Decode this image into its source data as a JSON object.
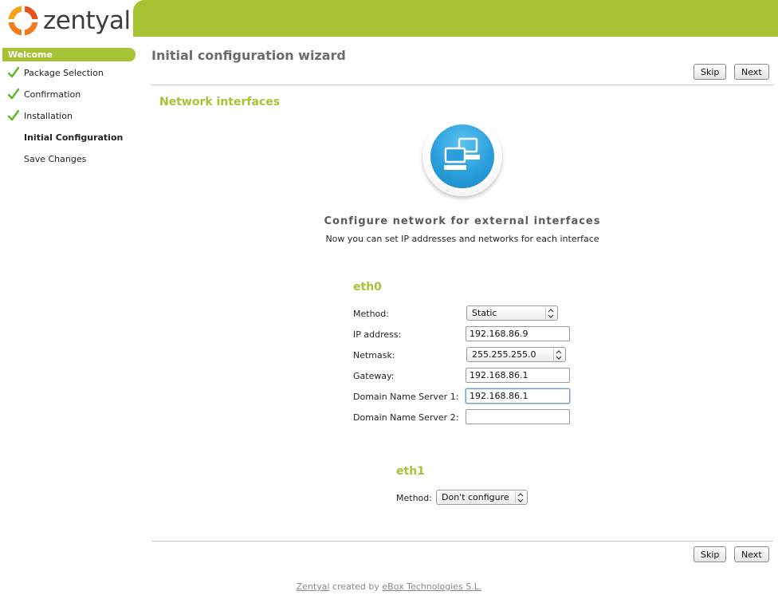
{
  "header": {
    "logo_text": "zentyal"
  },
  "sidebar": {
    "welcome": "Welcome",
    "steps": [
      {
        "label": "Package Selection",
        "done": true
      },
      {
        "label": "Confirmation",
        "done": true
      },
      {
        "label": "Installation",
        "done": true
      },
      {
        "label": "Initial Configuration",
        "done": false,
        "current": true
      },
      {
        "label": "Save Changes",
        "done": false
      }
    ]
  },
  "main": {
    "title": "Initial configuration wizard",
    "skip_label": "Skip",
    "next_label": "Next",
    "section_title": "Network interfaces",
    "subtitle": "Configure network for external interfaces",
    "description": "Now you can set IP addresses and networks for each interface",
    "eth0": {
      "name": "eth0",
      "method_label": "Method:",
      "method_value": "Static",
      "ip_label": "IP address:",
      "ip_value": "192.168.86.9",
      "netmask_label": "Netmask:",
      "netmask_value": "255.255.255.0",
      "gateway_label": "Gateway:",
      "gateway_value": "192.168.86.1",
      "dns1_label": "Domain Name Server 1:",
      "dns1_value": "192.168.86.1",
      "dns2_label": "Domain Name Server 2:",
      "dns2_value": ""
    },
    "eth1": {
      "name": "eth1",
      "method_label": "Method:",
      "method_value": "Don't configure"
    }
  },
  "footer": {
    "brand": "Zentyal",
    "created_by": "created by",
    "company": "eBox Technologies S.L."
  },
  "colors": {
    "accent": "#a5c334",
    "title_gray": "#6b6b6b",
    "check_green": "#5cb82a"
  }
}
